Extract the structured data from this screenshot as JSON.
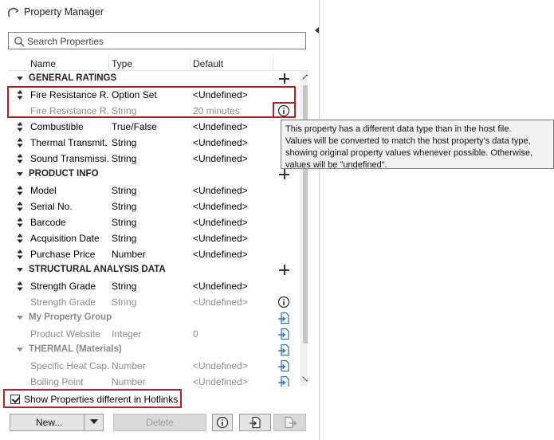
{
  "window": {
    "title": "Property Manager"
  },
  "search": {
    "placeholder": "Search Properties"
  },
  "columns": {
    "name": "Name",
    "type": "Type",
    "default": "Default"
  },
  "groups": [
    {
      "name": "GENERAL RATINGS"
    },
    {
      "name": "PRODUCT INFO"
    },
    {
      "name": "STRUCTURAL ANALYSIS DATA"
    },
    {
      "name": "My Property Group"
    },
    {
      "name": "THERMAL (Materials)"
    }
  ],
  "rows": [
    {
      "name": "Fire Resistance R...",
      "type": "Option Set",
      "default": "<Undefined>"
    },
    {
      "name": "Fire Resistance R...",
      "type": "String",
      "default": "20 minutes"
    },
    {
      "name": "Combustible",
      "type": "True/False",
      "default": "<Undefined>"
    },
    {
      "name": "Thermal Transmit...",
      "type": "String",
      "default": "<Undefined>"
    },
    {
      "name": "Sound Transmissi...",
      "type": "String",
      "default": "<Undefined>"
    },
    {
      "name": "Model",
      "type": "String",
      "default": "<Undefined>"
    },
    {
      "name": "Serial No.",
      "type": "String",
      "default": "<Undefined>"
    },
    {
      "name": "Barcode",
      "type": "String",
      "default": "<Undefined>"
    },
    {
      "name": "Acquisition Date",
      "type": "String",
      "default": "<Undefined>"
    },
    {
      "name": "Purchase Price",
      "type": "Number",
      "default": "<Undefined>"
    },
    {
      "name": "Strength Grade",
      "type": "String",
      "default": "<Undefined>"
    },
    {
      "name": "Strength Grade",
      "type": "String",
      "default": "<Undefined>"
    },
    {
      "name": "Product Website",
      "type": "Integer",
      "default": "0"
    },
    {
      "name": "Specific Heat Cap...",
      "type": "Number",
      "default": "<Undefined>"
    },
    {
      "name": "Boiling Point",
      "type": "Number",
      "default": "<Undefined>"
    }
  ],
  "tooltip": {
    "line1": "This property has a different data type than in the host file.",
    "line2": "Values will be converted to match the host property's data type,",
    "line3": "showing original property values whenever possible. Otherwise,",
    "line4": "values will be \"undefined\"."
  },
  "footer": {
    "show_label": "Show Properties different in Hotlinks",
    "show_checked": true,
    "new_label": "New...",
    "delete_label": "Delete"
  },
  "colors": {
    "highlight_border": "#b22227",
    "accent_blue": "#1e6fc8",
    "dim_text": "#8c8c8c"
  },
  "icons": [
    "search-icon",
    "info-icon",
    "import-icon",
    "export-icon",
    "sort-arrows-icon",
    "plus-icon"
  ]
}
